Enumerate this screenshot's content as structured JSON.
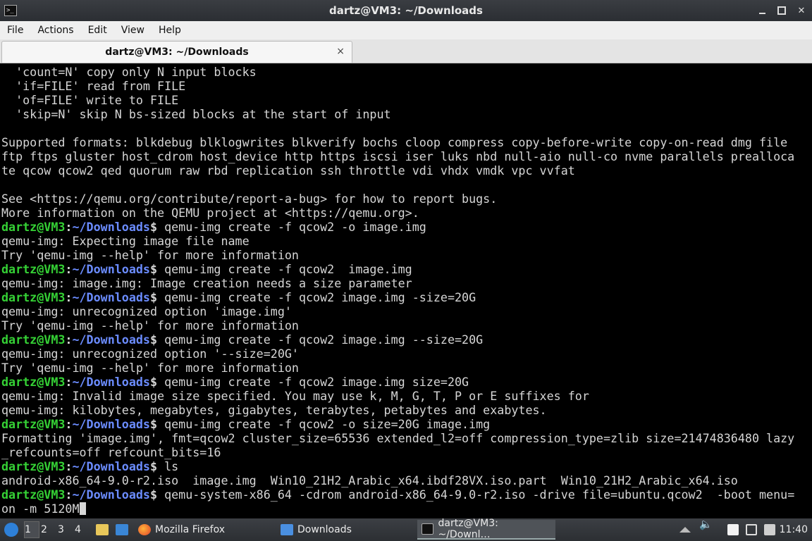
{
  "window": {
    "title": "dartz@VM3: ~/Downloads",
    "app_icon": "terminal-icon",
    "controls": [
      "minimize-icon",
      "maximize-icon",
      "close-icon"
    ]
  },
  "menu": [
    "File",
    "Actions",
    "Edit",
    "View",
    "Help"
  ],
  "tab": {
    "label": "dartz@VM3: ~/Downloads",
    "close": "×"
  },
  "prompt": {
    "user": "dartz@VM3",
    "sep": ":",
    "path": "~/Downloads",
    "sign": "$"
  },
  "colors": {
    "prompt_user": "#35d135",
    "prompt_path": "#6b8cff",
    "terminal_bg": "#000000",
    "terminal_fg": "#d6d6d6"
  },
  "terminal": {
    "lines": [
      {
        "type": "out",
        "text": "  'count=N' copy only N input blocks"
      },
      {
        "type": "out",
        "text": "  'if=FILE' read from FILE"
      },
      {
        "type": "out",
        "text": "  'of=FILE' write to FILE"
      },
      {
        "type": "out",
        "text": "  'skip=N' skip N bs-sized blocks at the start of input"
      },
      {
        "type": "out",
        "text": ""
      },
      {
        "type": "out",
        "text": "Supported formats: blkdebug blklogwrites blkverify bochs cloop compress copy-before-write copy-on-read dmg file"
      },
      {
        "type": "out",
        "text": "ftp ftps gluster host_cdrom host_device http https iscsi iser luks nbd null-aio null-co nvme parallels prealloca"
      },
      {
        "type": "out",
        "text": "te qcow qcow2 qed quorum raw rbd replication ssh throttle vdi vhdx vmdk vpc vvfat"
      },
      {
        "type": "out",
        "text": ""
      },
      {
        "type": "out",
        "text": "See <https://qemu.org/contribute/report-a-bug> for how to report bugs."
      },
      {
        "type": "out",
        "text": "More information on the QEMU project at <https://qemu.org>."
      },
      {
        "type": "cmd",
        "text": " qemu-img create -f qcow2 -o image.img"
      },
      {
        "type": "out",
        "text": "qemu-img: Expecting image file name"
      },
      {
        "type": "out",
        "text": "Try 'qemu-img --help' for more information"
      },
      {
        "type": "cmd",
        "text": " qemu-img create -f qcow2  image.img"
      },
      {
        "type": "out",
        "text": "qemu-img: image.img: Image creation needs a size parameter"
      },
      {
        "type": "cmd",
        "text": " qemu-img create -f qcow2 image.img -size=20G"
      },
      {
        "type": "out",
        "text": "qemu-img: unrecognized option 'image.img'"
      },
      {
        "type": "out",
        "text": "Try 'qemu-img --help' for more information"
      },
      {
        "type": "cmd",
        "text": " qemu-img create -f qcow2 image.img --size=20G"
      },
      {
        "type": "out",
        "text": "qemu-img: unrecognized option '--size=20G'"
      },
      {
        "type": "out",
        "text": "Try 'qemu-img --help' for more information"
      },
      {
        "type": "cmd",
        "text": " qemu-img create -f qcow2 image.img size=20G"
      },
      {
        "type": "out",
        "text": "qemu-img: Invalid image size specified. You may use k, M, G, T, P or E suffixes for"
      },
      {
        "type": "out",
        "text": "qemu-img: kilobytes, megabytes, gigabytes, terabytes, petabytes and exabytes."
      },
      {
        "type": "cmd",
        "text": " qemu-img create -f qcow2 -o size=20G image.img"
      },
      {
        "type": "out",
        "text": "Formatting 'image.img', fmt=qcow2 cluster_size=65536 extended_l2=off compression_type=zlib size=21474836480 lazy"
      },
      {
        "type": "out",
        "text": "_refcounts=off refcount_bits=16"
      },
      {
        "type": "cmd",
        "text": " ls"
      },
      {
        "type": "out",
        "text": "android-x86_64-9.0-r2.iso  image.img  Win10_21H2_Arabic_x64.ibdf28VX.iso.part  Win10_21H2_Arabic_x64.iso"
      },
      {
        "type": "cmd",
        "text": " qemu-system-x86_64 -cdrom android-x86_64-9.0-r2.iso -drive file=ubuntu.qcow2  -boot menu="
      },
      {
        "type": "out",
        "text": "on -m 5120M",
        "cursor": true
      }
    ]
  },
  "taskbar": {
    "start_icon": "start-menu-icon",
    "workspaces": [
      "1",
      "2",
      "3",
      "4"
    ],
    "active_workspace": "1",
    "quicklaunch": [
      "file-manager-icon",
      "desktop-icon"
    ],
    "tasks": [
      {
        "label": "Mozilla Firefox",
        "icon": "firefox-icon"
      },
      {
        "label": "Downloads",
        "icon": "folder-icon"
      },
      {
        "label": "dartz@VM3: ~/Downl…",
        "icon": "terminal-icon"
      }
    ],
    "tray": [
      "eject-icon",
      "volume-icon",
      "clipboard-icon",
      "network-icon",
      "notifications-icon"
    ],
    "clock": "11:40"
  }
}
